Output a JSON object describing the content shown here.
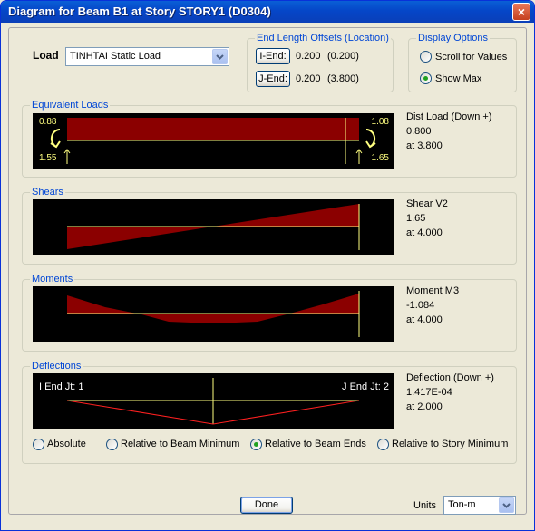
{
  "window": {
    "title": "Diagram for Beam B1 at Story STORY1 (D0304)",
    "close_glyph": "×"
  },
  "load": {
    "label": "Load",
    "selected": "TINHTAI Static Load"
  },
  "end_offsets": {
    "title": "End Length Offsets (Location)",
    "i_end": {
      "button": "I-End:",
      "value": "0.200",
      "location": "(0.200)"
    },
    "j_end": {
      "button": "J-End:",
      "value": "0.200",
      "location": "(3.800)"
    }
  },
  "display_options": {
    "title": "Display Options",
    "options": [
      {
        "label": "Scroll for Values",
        "checked": false
      },
      {
        "label": "Show Max",
        "checked": true
      }
    ]
  },
  "equivalent_loads": {
    "title": "Equivalent Loads",
    "left_top": "0.88",
    "left_bottom": "1.55",
    "right_top": "1.08",
    "right_bottom": "1.65",
    "info": {
      "label": "Dist Load (Down +)",
      "value": "0.800",
      "location": "at 3.800"
    }
  },
  "shears": {
    "title": "Shears",
    "info": {
      "label": "Shear V2",
      "value": "1.65",
      "location": "at 4.000"
    }
  },
  "moments": {
    "title": "Moments",
    "info": {
      "label": "Moment M3",
      "value": "-1.084",
      "location": "at 4.000"
    }
  },
  "deflections": {
    "title": "Deflections",
    "left_label": "I End Jt: 1",
    "right_label": "J End Jt: 2",
    "info": {
      "label": "Deflection (Down +)",
      "value": "1.417E-04",
      "location": "at 2.000"
    },
    "options": [
      {
        "label": "Absolute",
        "checked": false
      },
      {
        "label": "Relative to Beam Minimum",
        "checked": false
      },
      {
        "label": "Relative to Beam Ends",
        "checked": true
      },
      {
        "label": "Relative to Story Minimum",
        "checked": false
      }
    ]
  },
  "done_button": "Done",
  "units": {
    "label": "Units",
    "selected": "Ton-m"
  },
  "colors": {
    "diagram_fill": "#8b0000",
    "axis_line": "#ffff80",
    "deflected_shape": "#ff2020",
    "group_title": "#0046d5"
  }
}
